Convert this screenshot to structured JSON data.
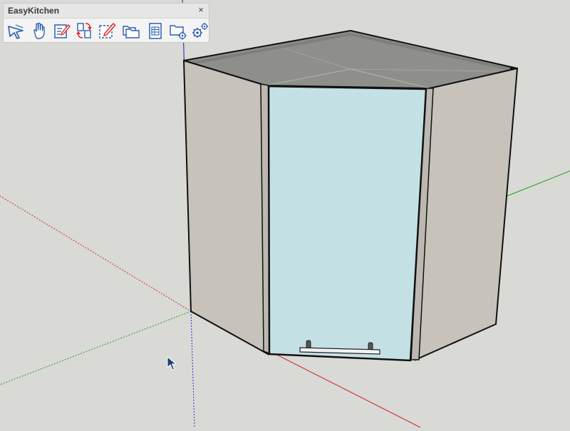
{
  "toolbar": {
    "title": "EasyKitchen",
    "close_label": "×",
    "buttons": [
      {
        "name": "select-tool-icon"
      },
      {
        "name": "hand-tool-icon"
      },
      {
        "name": "edit-document-icon"
      },
      {
        "name": "swap-doors-icon"
      },
      {
        "name": "edit-dashed-icon"
      },
      {
        "name": "folders-icon"
      },
      {
        "name": "table-sheet-icon"
      },
      {
        "name": "folder-settings-icon"
      },
      {
        "name": "settings-gear-icon"
      }
    ]
  },
  "colors": {
    "background": "#d9d9d6",
    "cabinet_side": "#c8c4bd",
    "cabinet_top": "#8e8e8b",
    "door_glass": "#c6e2e6",
    "axis_red": "#d02020",
    "axis_green": "#1fa31f",
    "axis_blue": "#2020b0",
    "icon_blue": "#2b5fae"
  }
}
